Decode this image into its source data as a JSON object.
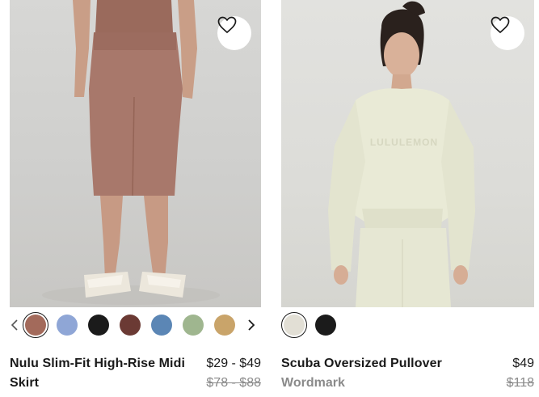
{
  "products": [
    {
      "name": "Nulu Slim-Fit High-Rise Midi Skirt",
      "price": "$29 - $49",
      "was_price": "$78 - $88",
      "wishlist_icon": "heart-outline-icon",
      "prev_icon": "chevron-left-icon",
      "next_icon": "chevron-right-icon",
      "swatches": [
        {
          "color": "#a36a5b",
          "selected": true
        },
        {
          "color": "#8fa6d6"
        },
        {
          "color": "#1b1b1b"
        },
        {
          "color": "#6b3a34"
        },
        {
          "color": "#5b86b5"
        },
        {
          "color": "#9fb68f"
        },
        {
          "color": "#c9a46a"
        }
      ]
    },
    {
      "name": "Scuba Oversized Pullover",
      "subtitle": "Wordmark",
      "price": "$49",
      "was_price": "$118",
      "wishlist_icon": "heart-outline-icon",
      "swatches": [
        {
          "color": "#e2dfd5",
          "selected": true
        },
        {
          "color": "#1b1b1b"
        }
      ]
    }
  ]
}
